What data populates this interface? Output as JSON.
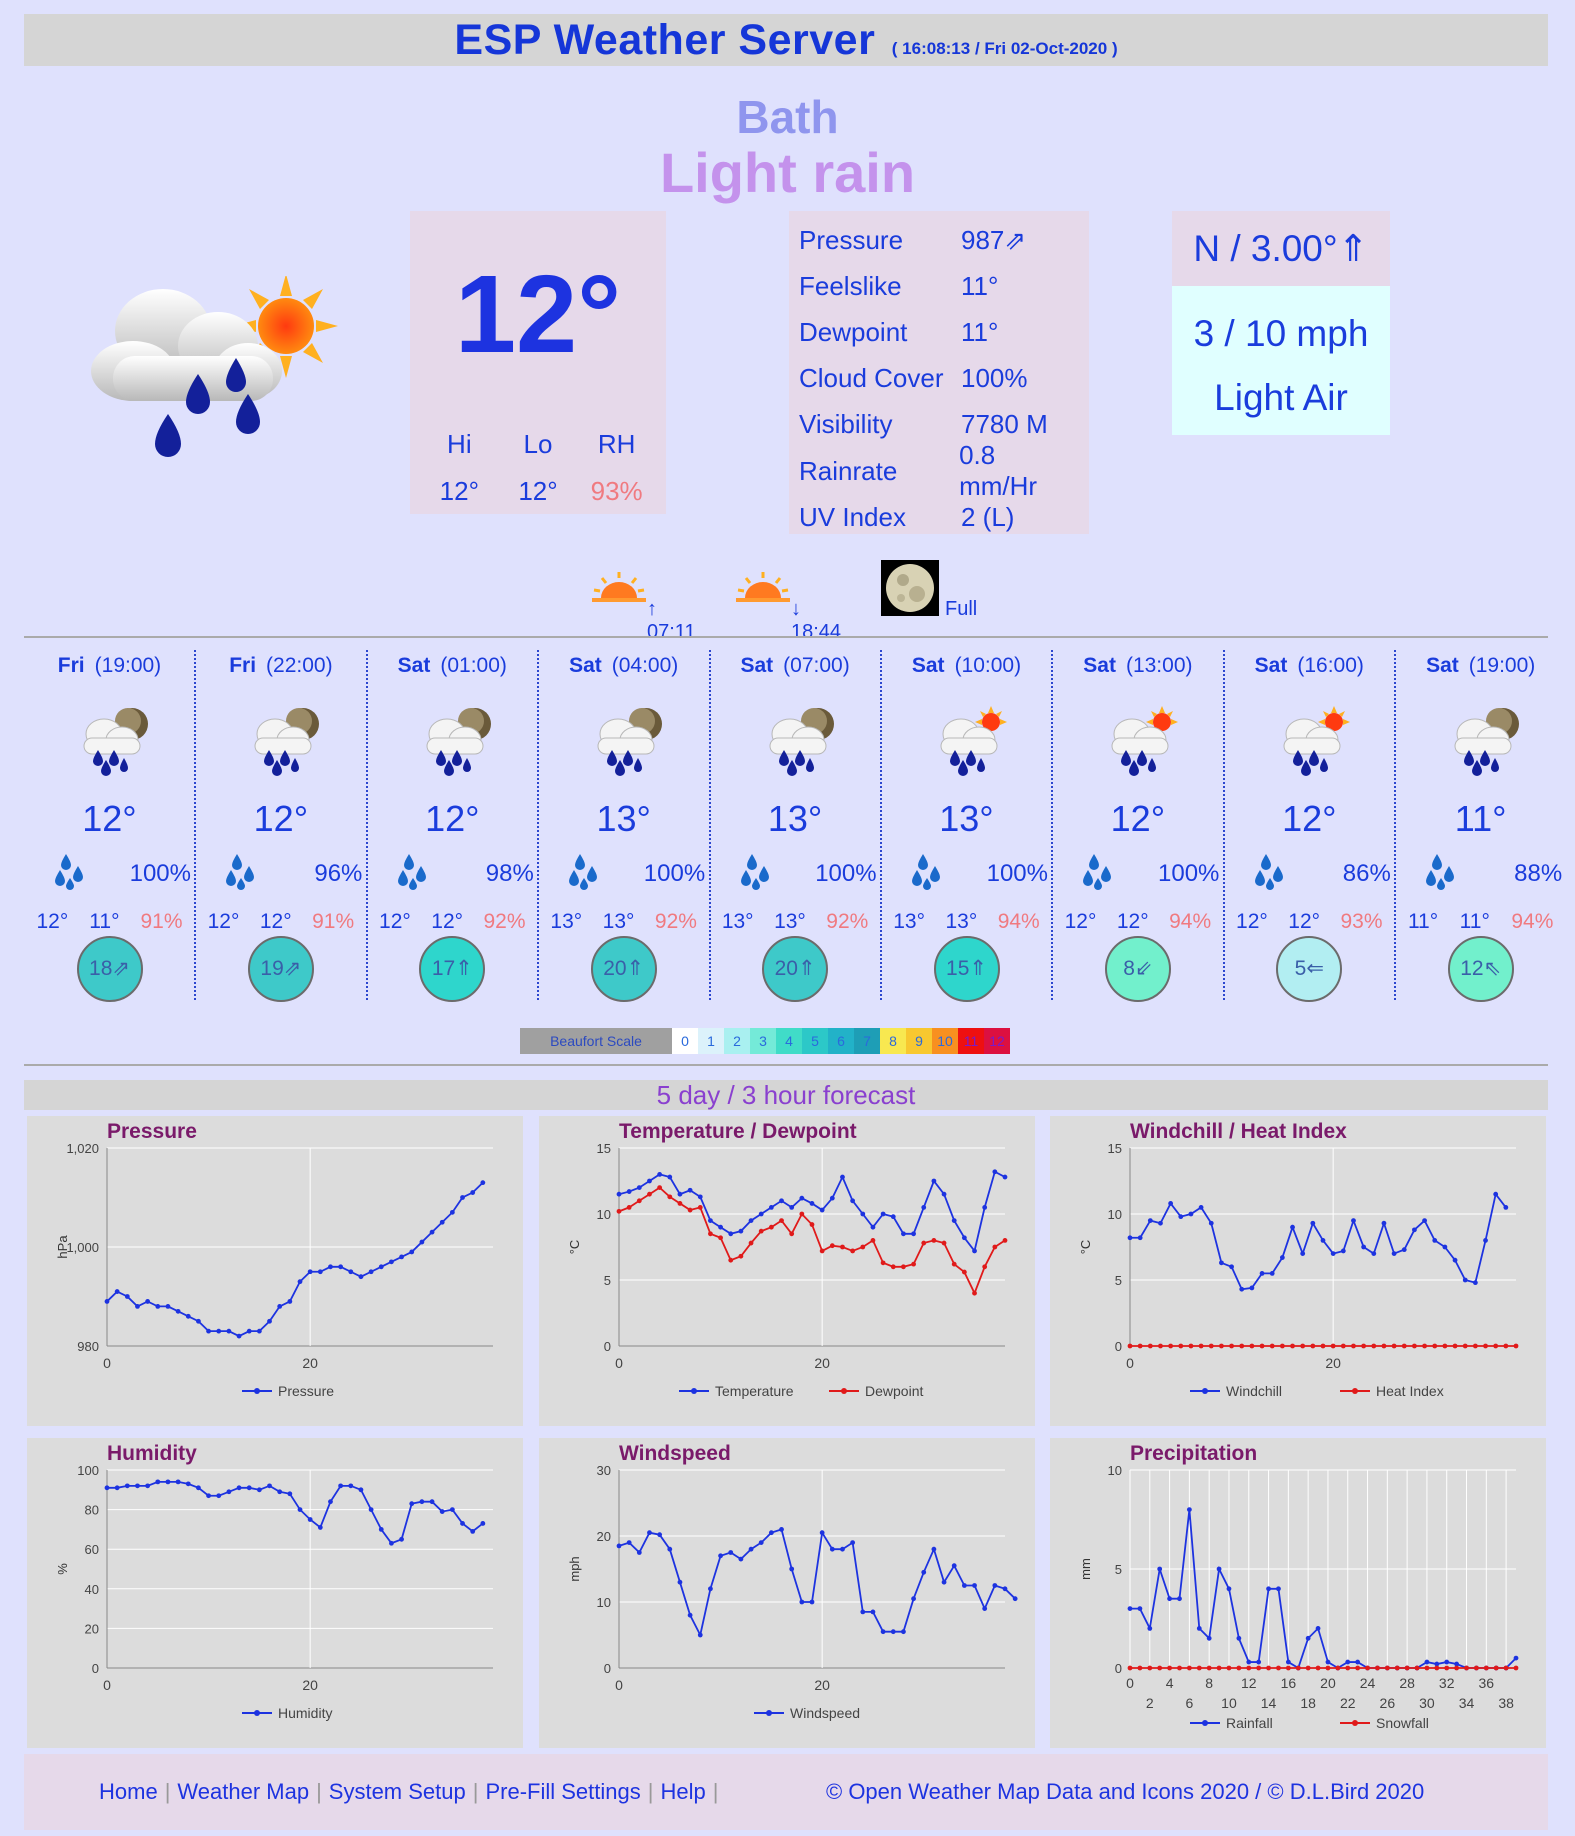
{
  "header": {
    "title": "ESP Weather Server",
    "timestamp": "( 16:08:13 / Fri 02-Oct-2020 )"
  },
  "location": "Bath",
  "condition": "Light rain",
  "current": {
    "temp": "12°",
    "hilo_labels": [
      "Hi",
      "Lo",
      "RH"
    ],
    "hilo_values": [
      "12°",
      "12°",
      "93%"
    ],
    "details": [
      {
        "k": "Pressure",
        "v": "987⇗"
      },
      {
        "k": "Feelslike",
        "v": "11°"
      },
      {
        "k": "Dewpoint",
        "v": "11°"
      },
      {
        "k": "Cloud Cover",
        "v": "100%"
      },
      {
        "k": "Visibility",
        "v": "7780 M"
      },
      {
        "k": "Rainrate",
        "v": "0.8 mm/Hr"
      },
      {
        "k": "UV Index",
        "v": "2 (L)"
      }
    ],
    "wind_dir": "N / 3.00°⇑",
    "wind_speed": "3 / 10 mph",
    "wind_desc": "Light Air"
  },
  "astro": {
    "sunrise": "↑ 07:11",
    "sunset": "↓ 18:44",
    "moon": "Full"
  },
  "forecast": [
    {
      "day": "Fri",
      "time": "(19:00)",
      "temp": "12°",
      "rain": "100%",
      "hi": "12°",
      "lo": "11°",
      "rh": "91%",
      "wind": "18⇗",
      "bf": "#3ec9c9",
      "icon": "moon-cloud-rain-icon"
    },
    {
      "day": "Fri",
      "time": "(22:00)",
      "temp": "12°",
      "rain": "96%",
      "hi": "12°",
      "lo": "12°",
      "rh": "91%",
      "wind": "19⇗",
      "bf": "#3ec9c9",
      "icon": "moon-cloud-rain-icon"
    },
    {
      "day": "Sat",
      "time": "(01:00)",
      "temp": "12°",
      "rain": "98%",
      "hi": "12°",
      "lo": "12°",
      "rh": "92%",
      "wind": "17⇑",
      "bf": "#2ed6cc",
      "icon": "moon-cloud-rain-icon"
    },
    {
      "day": "Sat",
      "time": "(04:00)",
      "temp": "13°",
      "rain": "100%",
      "hi": "13°",
      "lo": "13°",
      "rh": "92%",
      "wind": "20⇑",
      "bf": "#3ec9c9",
      "icon": "moon-cloud-rain-icon"
    },
    {
      "day": "Sat",
      "time": "(07:00)",
      "temp": "13°",
      "rain": "100%",
      "hi": "13°",
      "lo": "13°",
      "rh": "92%",
      "wind": "20⇑",
      "bf": "#3ec9c9",
      "icon": "moon-cloud-rain-icon"
    },
    {
      "day": "Sat",
      "time": "(10:00)",
      "temp": "13°",
      "rain": "100%",
      "hi": "13°",
      "lo": "13°",
      "rh": "94%",
      "wind": "15⇑",
      "bf": "#2ed6cc",
      "icon": "sun-cloud-rain-icon"
    },
    {
      "day": "Sat",
      "time": "(13:00)",
      "temp": "12°",
      "rain": "100%",
      "hi": "12°",
      "lo": "12°",
      "rh": "94%",
      "wind": "8⇙",
      "bf": "#72f0cc",
      "icon": "sun-cloud-rain-icon"
    },
    {
      "day": "Sat",
      "time": "(16:00)",
      "temp": "12°",
      "rain": "86%",
      "hi": "12°",
      "lo": "12°",
      "rh": "93%",
      "wind": "5⇐",
      "bf": "#b2eef2",
      "icon": "sun-cloud-rain-icon"
    },
    {
      "day": "Sat",
      "time": "(19:00)",
      "temp": "11°",
      "rain": "88%",
      "hi": "11°",
      "lo": "11°",
      "rh": "94%",
      "wind": "12⇖",
      "bf": "#72f0cc",
      "icon": "moon-cloud-rain-icon"
    }
  ],
  "beaufort": {
    "label": "Beaufort Scale",
    "cells": [
      {
        "n": "0",
        "c": "#ffffff"
      },
      {
        "n": "1",
        "c": "#dcf2fb"
      },
      {
        "n": "2",
        "c": "#a9f0f0"
      },
      {
        "n": "3",
        "c": "#74ead8"
      },
      {
        "n": "4",
        "c": "#40dcc8"
      },
      {
        "n": "5",
        "c": "#2cc8c8"
      },
      {
        "n": "6",
        "c": "#22b2c8"
      },
      {
        "n": "7",
        "c": "#1e9eb6"
      },
      {
        "n": "8",
        "c": "#f8e850"
      },
      {
        "n": "9",
        "c": "#f8c830"
      },
      {
        "n": "10",
        "c": "#f89020"
      },
      {
        "n": "11",
        "c": "#ee1010"
      },
      {
        "n": "12",
        "c": "#dc1040"
      }
    ]
  },
  "forecast_title": "5 day / 3 hour forecast",
  "chart_data": [
    {
      "type": "line",
      "title": "Pressure",
      "ylabel": "hPa",
      "ylim": [
        980,
        1020
      ],
      "yticks": [
        "980",
        "1,000",
        "1,020"
      ],
      "xticks": [
        "0",
        "20"
      ],
      "series": [
        {
          "name": "Pressure",
          "color": "#1d33e0",
          "values": [
            989,
            991,
            990,
            988,
            989,
            988,
            988,
            987,
            986,
            985,
            983,
            983,
            983,
            982,
            983,
            983,
            985,
            988,
            989,
            993,
            995,
            995,
            996,
            996,
            995,
            994,
            995,
            996,
            997,
            998,
            999,
            1001,
            1003,
            1005,
            1007,
            1010,
            1011,
            1013
          ]
        }
      ]
    },
    {
      "type": "line",
      "title": "Temperature / Dewpoint",
      "ylabel": "°C",
      "ylim": [
        0,
        15
      ],
      "yticks": [
        "0",
        "5",
        "10",
        "15"
      ],
      "xticks": [
        "0",
        "20"
      ],
      "series": [
        {
          "name": "Temperature",
          "color": "#1d33e0",
          "values": [
            11.5,
            11.7,
            12,
            12.5,
            13,
            12.8,
            11.5,
            11.8,
            11.3,
            9.5,
            9,
            8.5,
            8.7,
            9.5,
            10,
            10.5,
            11,
            10.5,
            11.2,
            10.8,
            10.3,
            11.2,
            12.8,
            11,
            10,
            9,
            10,
            9.8,
            8.5,
            8.5,
            10.5,
            12.5,
            11.5,
            9.5,
            8.2,
            7.2,
            10.5,
            13.2,
            12.8
          ]
        },
        {
          "name": "Dewpoint",
          "color": "#e01a1a",
          "values": [
            10.2,
            10.5,
            11,
            11.5,
            12,
            11.3,
            10.8,
            10.3,
            10.5,
            8.5,
            8.2,
            6.5,
            6.8,
            7.8,
            8.7,
            9,
            9.5,
            8.5,
            10,
            9.2,
            7.2,
            7.6,
            7.5,
            7.2,
            7.5,
            8,
            6.3,
            6,
            6,
            6.2,
            7.8,
            8,
            7.8,
            6.2,
            5.6,
            4,
            6,
            7.5,
            8
          ]
        }
      ]
    },
    {
      "type": "line",
      "title": "Windchill / Heat Index",
      "ylabel": "°C",
      "ylim": [
        0,
        15
      ],
      "yticks": [
        "0",
        "5",
        "10",
        "15"
      ],
      "xticks": [
        "0",
        "20"
      ],
      "series": [
        {
          "name": "Windchill",
          "color": "#1d33e0",
          "values": [
            8.2,
            8.2,
            9.5,
            9.3,
            10.8,
            9.8,
            10,
            10.5,
            9.3,
            6.3,
            6,
            4.3,
            4.4,
            5.5,
            5.5,
            6.7,
            9,
            7,
            9.3,
            8,
            7,
            7.2,
            9.5,
            7.5,
            7,
            9.3,
            7,
            7.3,
            8.8,
            9.5,
            8,
            7.5,
            6.5,
            5,
            4.8,
            8,
            11.5,
            10.5
          ]
        },
        {
          "name": "Heat Index",
          "color": "#e01a1a",
          "values": [
            0,
            0,
            0,
            0,
            0,
            0,
            0,
            0,
            0,
            0,
            0,
            0,
            0,
            0,
            0,
            0,
            0,
            0,
            0,
            0,
            0,
            0,
            0,
            0,
            0,
            0,
            0,
            0,
            0,
            0,
            0,
            0,
            0,
            0,
            0,
            0,
            0,
            0,
            0
          ]
        }
      ]
    },
    {
      "type": "line",
      "title": "Humidity",
      "ylabel": "%",
      "ylim": [
        0,
        100
      ],
      "yticks": [
        "0",
        "20",
        "40",
        "60",
        "80",
        "100"
      ],
      "xticks": [
        "0",
        "20"
      ],
      "series": [
        {
          "name": "Humidity",
          "color": "#1d33e0",
          "values": [
            91,
            91,
            92,
            92,
            92,
            94,
            94,
            94,
            93,
            91,
            87,
            87,
            89,
            91,
            91,
            90,
            92,
            89,
            88,
            80,
            75,
            71,
            84,
            92,
            92,
            90,
            80,
            70,
            63,
            65,
            83,
            84,
            84,
            79,
            80,
            73,
            69,
            73
          ]
        }
      ]
    },
    {
      "type": "line",
      "title": "Windspeed",
      "ylabel": "mph",
      "ylim": [
        0,
        30
      ],
      "yticks": [
        "0",
        "10",
        "20",
        "30"
      ],
      "xticks": [
        "0",
        "20"
      ],
      "series": [
        {
          "name": "Windspeed",
          "color": "#1d33e0",
          "values": [
            18.5,
            19,
            17.5,
            20.5,
            20.2,
            18,
            13,
            8,
            5,
            12,
            17,
            17.5,
            16.5,
            18,
            19,
            20.5,
            21,
            15,
            10,
            10,
            20.5,
            18,
            18,
            19,
            8.5,
            8.5,
            5.5,
            5.5,
            5.5,
            10.5,
            14.5,
            18,
            13,
            15.5,
            12.5,
            12.5,
            9,
            12.5,
            12,
            10.5
          ]
        }
      ]
    },
    {
      "type": "line",
      "title": "Precipitation",
      "ylabel": "mm",
      "ylim": [
        0,
        10
      ],
      "yticks": [
        "0",
        "5",
        "10"
      ],
      "xticks": [
        "0",
        "2",
        "4",
        "6",
        "8",
        "10",
        "12",
        "14",
        "16",
        "18",
        "20",
        "22",
        "24",
        "26",
        "28",
        "30",
        "32",
        "34",
        "36",
        "38"
      ],
      "series": [
        {
          "name": "Rainfall",
          "color": "#1d33e0",
          "values": [
            3,
            3,
            2,
            5,
            3.5,
            3.5,
            8,
            2,
            1.5,
            5,
            4,
            1.5,
            0.3,
            0.3,
            4,
            4,
            0.3,
            0,
            1.5,
            2,
            0.3,
            0,
            0.3,
            0.3,
            0,
            0,
            0,
            0,
            0,
            0,
            0.3,
            0.2,
            0.3,
            0.2,
            0,
            0,
            0,
            0,
            0,
            0.5
          ]
        },
        {
          "name": "Snowfall",
          "color": "#e01a1a",
          "values": [
            0,
            0,
            0,
            0,
            0,
            0,
            0,
            0,
            0,
            0,
            0,
            0,
            0,
            0,
            0,
            0,
            0,
            0,
            0,
            0,
            0,
            0,
            0,
            0,
            0,
            0,
            0,
            0,
            0,
            0,
            0,
            0,
            0,
            0,
            0,
            0,
            0,
            0,
            0,
            0
          ]
        }
      ]
    }
  ],
  "footer": {
    "nav": [
      "Home",
      "Weather Map",
      "System Setup",
      "Pre-Fill Settings",
      "Help"
    ],
    "copyright": "© Open Weather Map Data and Icons 2020 / © D.L.Bird 2020"
  }
}
